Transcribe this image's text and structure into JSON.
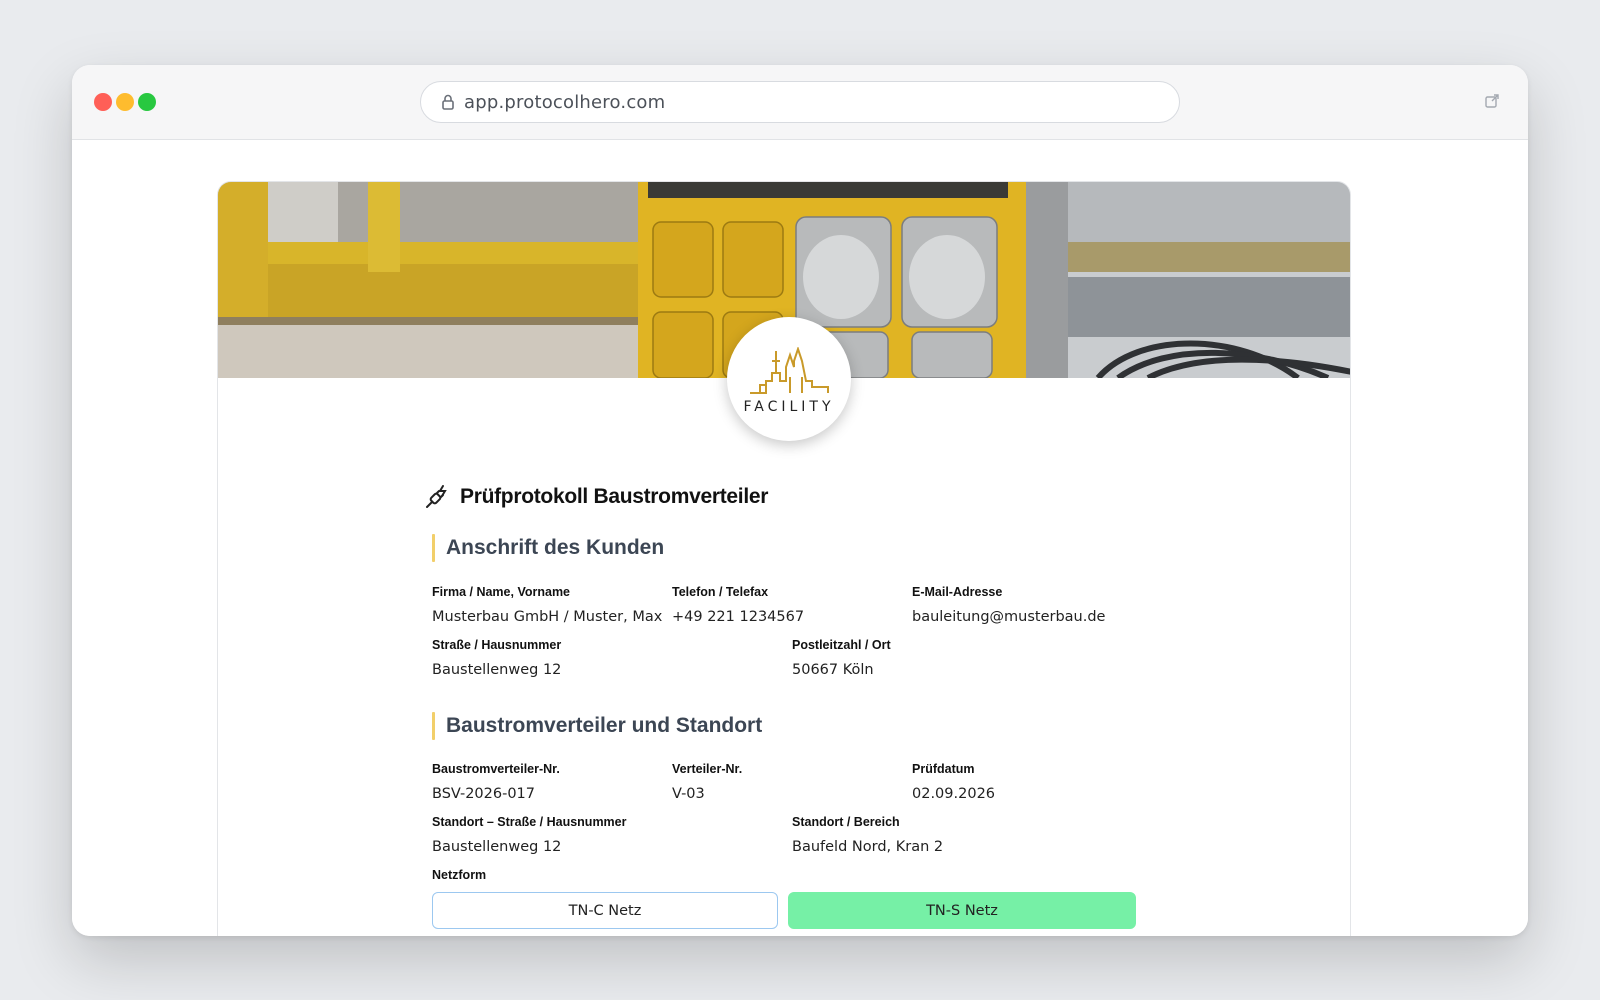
{
  "browser": {
    "url": "app.protocolhero.com"
  },
  "logo": {
    "text": "FACILITY"
  },
  "form": {
    "title": "Prüfprotokoll Baustromverteiler",
    "sections": [
      {
        "heading": "Anschrift des Kunden",
        "fields": {
          "name": {
            "label": "Firma / Name, Vorname",
            "value": "Musterbau GmbH / Muster, Max"
          },
          "phone": {
            "label": "Telefon / Telefax",
            "value": "+49 221 1234567"
          },
          "email": {
            "label": "E-Mail-Adresse",
            "value": "bauleitung@musterbau.de"
          },
          "street": {
            "label": "Straße / Hausnummer",
            "value": "Baustellenweg 12"
          },
          "city": {
            "label": "Postleitzahl / Ort",
            "value": "50667 Köln"
          }
        }
      },
      {
        "heading": "Baustromverteiler und Standort",
        "fields": {
          "bsv_nr": {
            "label": "Baustromverteiler-Nr.",
            "value": "BSV-2026-017"
          },
          "verteiler_nr": {
            "label": "Verteiler-Nr.",
            "value": "V-03"
          },
          "date": {
            "label": "Prüfdatum",
            "value": "02.09.2026"
          },
          "location_street": {
            "label": "Standort – Straße / Hausnummer",
            "value": "Baustellenweg 12"
          },
          "location_area": {
            "label": "Standort / Bereich",
            "value": "Baufeld Nord, Kran 2"
          },
          "netzform": {
            "label": "Netzform",
            "options": [
              "TN-C Netz",
              "TN-S Netz"
            ],
            "selected": "TN-S Netz"
          }
        }
      }
    ]
  },
  "colors": {
    "accent_bar": "#f2cf6a",
    "selected_option": "#76f0a6",
    "unselected_border": "#9cc8f0"
  }
}
